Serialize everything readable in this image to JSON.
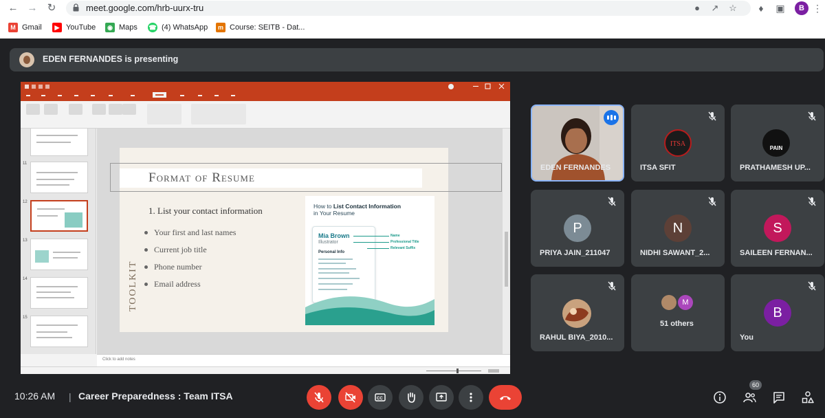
{
  "browser": {
    "url": "meet.google.com/hrb-uurx-tru",
    "profile_initial": "B",
    "bookmarks": [
      {
        "label": "Gmail",
        "icon": "gmail-icon",
        "color": "#ea4335"
      },
      {
        "label": "YouTube",
        "icon": "youtube-icon",
        "color": "#ff0000"
      },
      {
        "label": "Maps",
        "icon": "maps-icon",
        "color": "#34a853"
      },
      {
        "label": "(4) WhatsApp",
        "icon": "whatsapp-icon",
        "color": "#25d366"
      },
      {
        "label": "Course: SEITB - Dat...",
        "icon": "course-icon",
        "color": "#e37400"
      }
    ]
  },
  "presenting": {
    "text": "EDEN FERNANDES is presenting"
  },
  "slide": {
    "title": "Format of Resume",
    "heading": "1. List your contact information",
    "bullets": [
      "Your first and last names",
      "Current job title",
      "Phone number",
      "Email address"
    ],
    "side_label": "TOOLKIT",
    "howto": {
      "title_pre": "How to ",
      "title_bold": "List Contact Information",
      "title_post": "in Your Resume",
      "name": "Mia Brown",
      "role": "Illustrator",
      "section": "Personal Info",
      "labels": [
        "Name",
        "Professional Title",
        "Relevant Suffix"
      ]
    },
    "notes_placeholder": "Click to add notes"
  },
  "participants": [
    {
      "name": "EDEN FERNANDES",
      "type": "video",
      "speaking": true
    },
    {
      "name": "ITSA SFIT",
      "type": "logo",
      "logo_text": "ITSA",
      "muted": true
    },
    {
      "name": "PRATHAMESH UP...",
      "type": "logo",
      "logo_text": "PAIN",
      "muted": true
    },
    {
      "name": "PRIYA JAIN_211047",
      "type": "initial",
      "initial": "P",
      "color": "#7c8b95",
      "muted": true
    },
    {
      "name": "NIDHI SAWANT_2...",
      "type": "initial",
      "initial": "N",
      "color": "#5d4037",
      "muted": true
    },
    {
      "name": "SAILEEN FERNAN...",
      "type": "initial",
      "initial": "S",
      "color": "#c2185b",
      "muted": true
    },
    {
      "name": "RAHUL BIYA_2010...",
      "type": "photo",
      "muted": true
    },
    {
      "name": "51 others",
      "type": "others"
    },
    {
      "name": "You",
      "type": "initial",
      "initial": "B",
      "color": "#7b1fa2",
      "muted": true
    }
  ],
  "bottom": {
    "time": "10:26 AM",
    "separator": "|",
    "meeting": "Career Preparedness : Team ITSA",
    "people_count": "60"
  },
  "colors": {
    "meet_bg": "#202124",
    "tile_bg": "#3c4043",
    "danger": "#ea4335",
    "ppt_accent": "#c43e1c"
  }
}
